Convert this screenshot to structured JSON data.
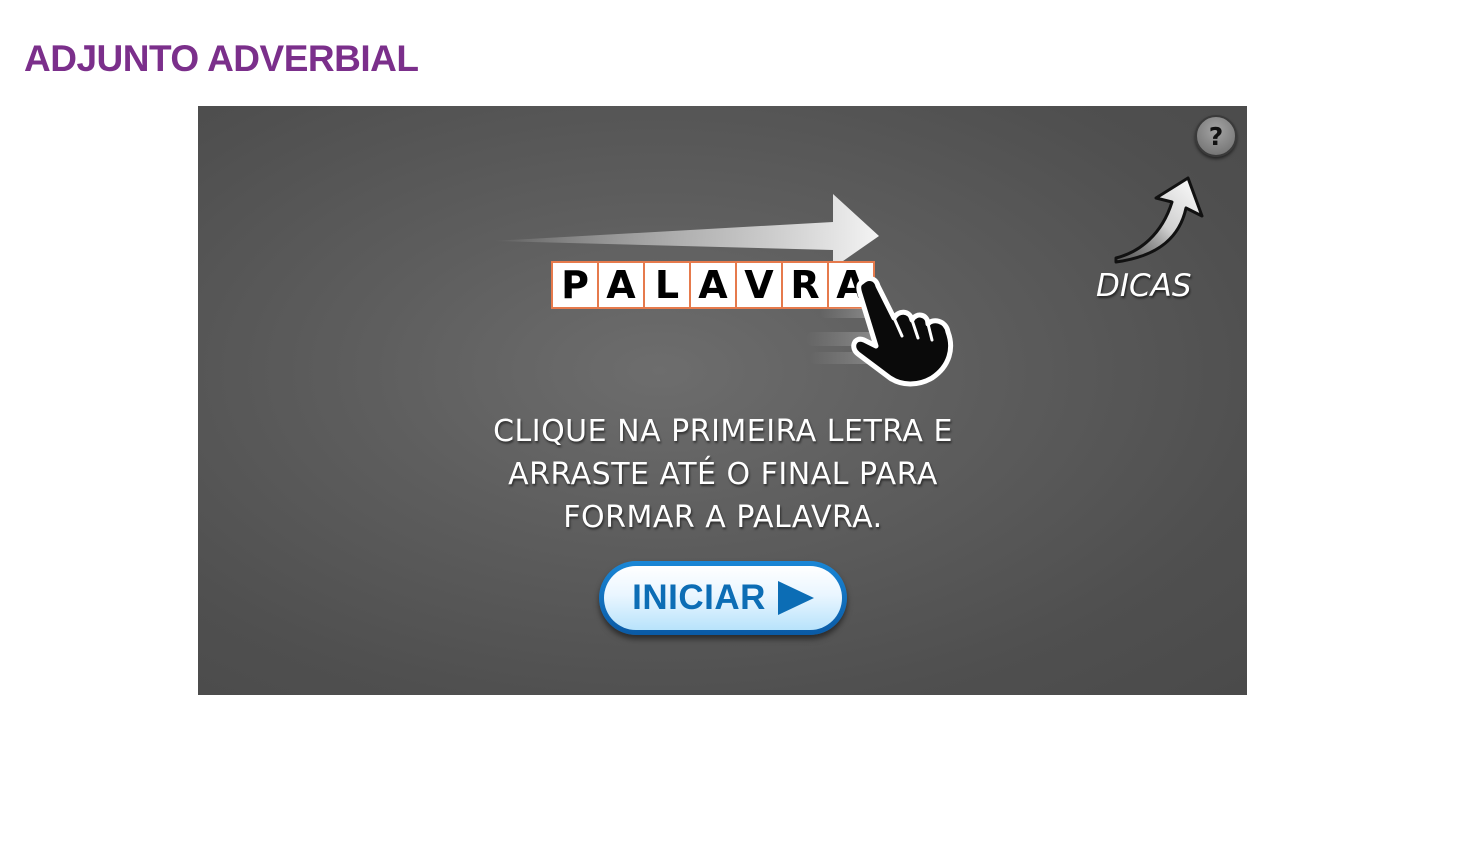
{
  "page": {
    "title": "ADJUNTO ADVERBIAL"
  },
  "game": {
    "help_icon": "?",
    "tips_label": "DICAS",
    "example_word": [
      "P",
      "A",
      "L",
      "A",
      "V",
      "R",
      "A"
    ],
    "instructions": [
      "CLIQUE NA PRIMEIRA LETRA E",
      "ARRASTE ATÉ O FINAL PARA",
      "FORMAR A PALAVRA."
    ],
    "start_label": "INICIAR",
    "icons": {
      "help": "question-mark-icon",
      "tips_arrow": "curved-arrow-icon",
      "swipe_arrow": "right-arrow-icon",
      "hand": "pointing-hand-icon",
      "play": "play-icon"
    },
    "colors": {
      "title": "#7b2f8b",
      "tile_border": "#e67a4c",
      "button_blue": "#0c6db5",
      "background": "#5e5e5e"
    }
  }
}
